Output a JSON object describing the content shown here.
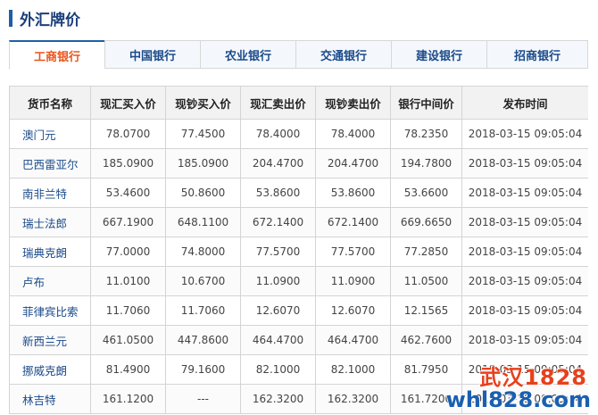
{
  "section": {
    "title": "外汇牌价"
  },
  "tabs": [
    {
      "label": "工商银行",
      "active": true
    },
    {
      "label": "中国银行",
      "active": false
    },
    {
      "label": "农业银行",
      "active": false
    },
    {
      "label": "交通银行",
      "active": false
    },
    {
      "label": "建设银行",
      "active": false
    },
    {
      "label": "招商银行",
      "active": false
    }
  ],
  "table": {
    "headers": [
      "货币名称",
      "现汇买入价",
      "现钞买入价",
      "现汇卖出价",
      "现钞卖出价",
      "银行中间价",
      "发布时间"
    ],
    "rows": [
      [
        "澳门元",
        "78.0700",
        "77.4500",
        "78.4000",
        "78.4000",
        "78.2350",
        "2018-03-15 09:05:04"
      ],
      [
        "巴西雷亚尔",
        "185.0900",
        "185.0900",
        "204.4700",
        "204.4700",
        "194.7800",
        "2018-03-15 09:05:04"
      ],
      [
        "南非兰特",
        "53.4600",
        "50.8600",
        "53.8600",
        "53.8600",
        "53.6600",
        "2018-03-15 09:05:04"
      ],
      [
        "瑞士法郎",
        "667.1900",
        "648.1100",
        "672.1400",
        "672.1400",
        "669.6650",
        "2018-03-15 09:05:04"
      ],
      [
        "瑞典克朗",
        "77.0000",
        "74.8000",
        "77.5700",
        "77.5700",
        "77.2850",
        "2018-03-15 09:05:04"
      ],
      [
        "卢布",
        "11.0100",
        "10.6700",
        "11.0900",
        "11.0900",
        "11.0500",
        "2018-03-15 09:05:04"
      ],
      [
        "菲律宾比索",
        "11.7060",
        "11.7060",
        "12.6070",
        "12.6070",
        "12.1565",
        "2018-03-15 09:05:04"
      ],
      [
        "新西兰元",
        "461.0500",
        "447.8600",
        "464.4700",
        "464.4700",
        "462.7600",
        "2018-03-15 09:05:04"
      ],
      [
        "挪威克朗",
        "81.4900",
        "79.1600",
        "82.1000",
        "82.1000",
        "81.7950",
        "2018-03-15 09:05:04"
      ],
      [
        "林吉特",
        "161.1200",
        "---",
        "162.3200",
        "162.3200",
        "161.7200",
        "2018-03-15 09:05:04"
      ]
    ]
  },
  "watermark": {
    "line1": "武汉1828",
    "line2": "whl828.com"
  }
}
